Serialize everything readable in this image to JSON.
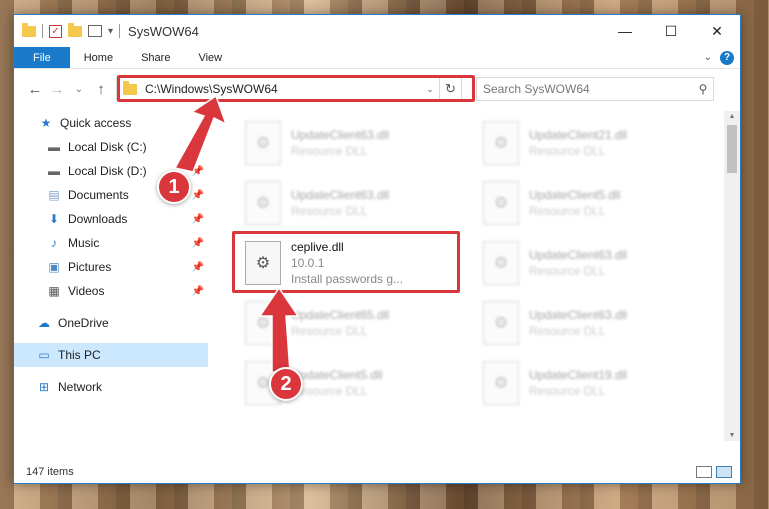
{
  "window": {
    "title": "SysWOW64",
    "controls": [
      "—",
      "☐",
      "✕"
    ]
  },
  "ribbon": {
    "tabs": [
      "File",
      "Home",
      "Share",
      "View"
    ]
  },
  "address": {
    "path": "C:\\Windows\\SysWOW64",
    "search_placeholder": "Search SysWOW64"
  },
  "sidebar": {
    "items": [
      {
        "label": "Quick access",
        "icon": "star-icon"
      },
      {
        "label": "Local Disk (C:)",
        "icon": "drive-icon"
      },
      {
        "label": "Local Disk (D:)",
        "icon": "drive-icon"
      },
      {
        "label": "Documents",
        "icon": "documents-icon"
      },
      {
        "label": "Downloads",
        "icon": "download-icon"
      },
      {
        "label": "Music",
        "icon": "music-icon"
      },
      {
        "label": "Pictures",
        "icon": "pictures-icon"
      },
      {
        "label": "Videos",
        "icon": "videos-icon"
      },
      {
        "label": "OneDrive",
        "icon": "cloud-icon"
      },
      {
        "label": "This PC",
        "icon": "computer-icon"
      },
      {
        "label": "Network",
        "icon": "network-icon"
      }
    ]
  },
  "files": [
    {
      "name": "UpdateClient63.dll",
      "desc": "Resource DLL"
    },
    {
      "name": "UpdateClient21.dll",
      "desc": "Resource DLL"
    },
    {
      "name": "UpdateClient63.dll",
      "desc": "Resource DLL"
    },
    {
      "name": "UpdateClient5.dll",
      "desc": "Resource DLL"
    },
    {
      "name": "ceplive.dll",
      "version": "10.0.1",
      "desc": "Install passwords g..."
    },
    {
      "name": "UpdateClient63.dll",
      "desc": "Resource DLL"
    },
    {
      "name": "UpdateClient65.dll",
      "desc": "Resource DLL"
    },
    {
      "name": "UpdateClient63.dll",
      "desc": "Resource DLL"
    },
    {
      "name": "UpdateClient5.dll",
      "desc": "Resource DLL"
    },
    {
      "name": "UpdateClient19.dll",
      "desc": "Resource DLL"
    }
  ],
  "status": {
    "count": "147 items"
  },
  "annotations": {
    "step1": "1",
    "step2": "2",
    "color": "#d9373c"
  }
}
